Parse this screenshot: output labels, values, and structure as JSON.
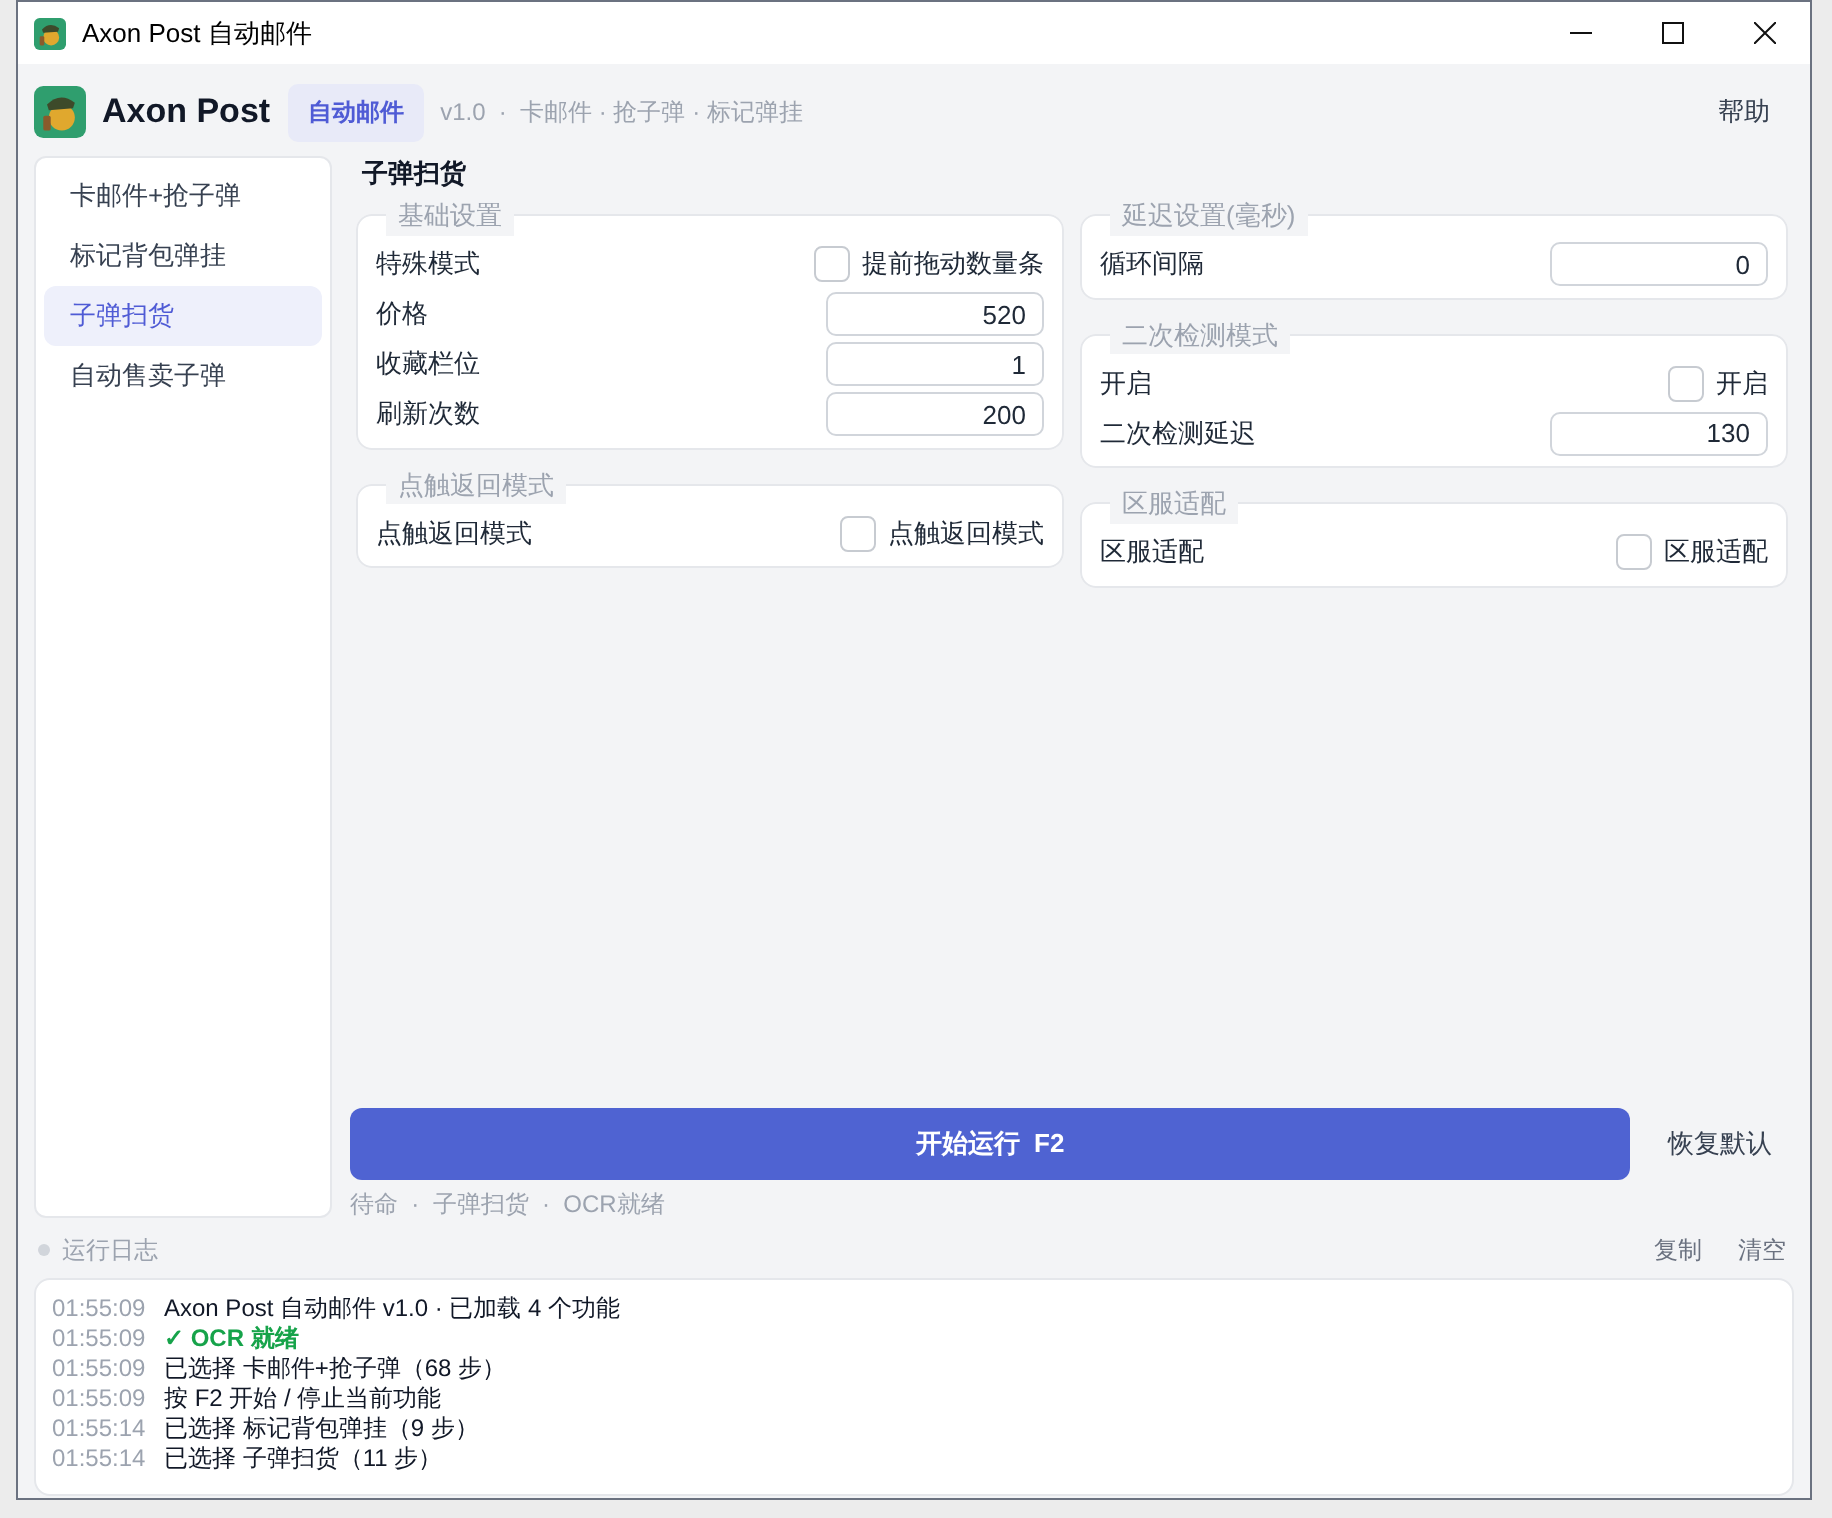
{
  "window": {
    "title": "Axon Post 自动邮件"
  },
  "header": {
    "app_name": "Axon Post",
    "tabs": [
      {
        "label": "自动邮件",
        "selected": true
      }
    ],
    "subtitle": "v1.0  ·  卡邮件 · 抢子弹 · 标记弹挂",
    "help": "帮助"
  },
  "sidebar": {
    "items": [
      {
        "label": "卡邮件+抢子弹",
        "selected": false
      },
      {
        "label": "标记背包弹挂",
        "selected": false
      },
      {
        "label": "子弹扫货",
        "selected": true
      },
      {
        "label": "自动售卖子弹",
        "selected": false
      }
    ]
  },
  "content": {
    "title": "子弹扫货",
    "columns": [
      [
        {
          "title": "基础设置",
          "rows": [
            {
              "kind": "checkbox",
              "label": "特殊模式",
              "option": "提前拖动数量条",
              "checked": false
            },
            {
              "kind": "number",
              "label": "价格",
              "value": "520"
            },
            {
              "kind": "number",
              "label": "收藏栏位",
              "value": "1"
            },
            {
              "kind": "number",
              "label": "刷新次数",
              "value": "200"
            }
          ]
        },
        {
          "title": "点触返回模式",
          "rows": [
            {
              "kind": "checkbox",
              "label": "点触返回模式",
              "option": "点触返回模式",
              "checked": false
            }
          ]
        }
      ],
      [
        {
          "title": "延迟设置(毫秒)",
          "rows": [
            {
              "kind": "number",
              "label": "循环间隔",
              "value": "0"
            }
          ]
        },
        {
          "title": "二次检测模式",
          "rows": [
            {
              "kind": "checkbox",
              "label": "开启",
              "option": "开启",
              "checked": false
            },
            {
              "kind": "number",
              "label": "二次检测延迟",
              "value": "130"
            }
          ]
        },
        {
          "title": "区服适配",
          "rows": [
            {
              "kind": "checkbox",
              "label": "区服适配",
              "option": "区服适配",
              "checked": false
            }
          ]
        }
      ]
    ],
    "start_button": "开始运行  F2",
    "reset_button": "恢复默认",
    "status": "待命  ·  子弹扫货  ·  OCR就绪"
  },
  "log": {
    "title": "运行日志",
    "actions": [
      "复制",
      "清空"
    ],
    "lines": [
      {
        "time": "01:55:09",
        "text": "Axon Post 自动邮件 v1.0 · 已加载 4 个功能",
        "kind": "info"
      },
      {
        "time": "01:55:09",
        "text": "✓ OCR 就绪",
        "kind": "success"
      },
      {
        "time": "01:55:09",
        "text": "已选择 卡邮件+抢子弹（68 步）",
        "kind": "info"
      },
      {
        "time": "01:55:09",
        "text": "按 F2 开始 / 停止当前功能",
        "kind": "info"
      },
      {
        "time": "01:55:14",
        "text": "已选择 标记背包弹挂（9 步）",
        "kind": "info"
      },
      {
        "time": "01:55:14",
        "text": "已选择 子弹扫货（11 步）",
        "kind": "info"
      }
    ]
  }
}
